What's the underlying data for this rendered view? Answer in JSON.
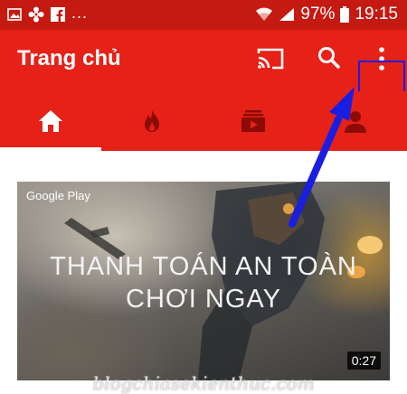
{
  "status_bar": {
    "icons_left": [
      "gallery-icon",
      "flower-app-icon",
      "facebook-icon"
    ],
    "more": "...",
    "icons_right": [
      "wifi-icon",
      "signal-icon"
    ],
    "battery": "97%",
    "time": "19:15"
  },
  "app_bar": {
    "title": "Trang chủ",
    "actions": [
      "cast-icon",
      "search-icon",
      "more-vert-icon"
    ],
    "highlight_color": "#1a1ee0"
  },
  "tabs": [
    {
      "icon": "home-icon",
      "selected": true
    },
    {
      "icon": "trending-fire-icon",
      "selected": false
    },
    {
      "icon": "subscriptions-icon",
      "selected": false
    },
    {
      "icon": "account-icon",
      "selected": false
    }
  ],
  "video_card": {
    "brand": "Google Play",
    "promo_line1": "THANH TOÁN AN TOÀN",
    "promo_line2": "CHƠI NGAY",
    "duration": "0:27"
  },
  "colors": {
    "primary": "#e62117",
    "status_bar": "#c41a12",
    "arrow": "#1a1ee0"
  },
  "watermark": "blogchiasekienthuc.com"
}
